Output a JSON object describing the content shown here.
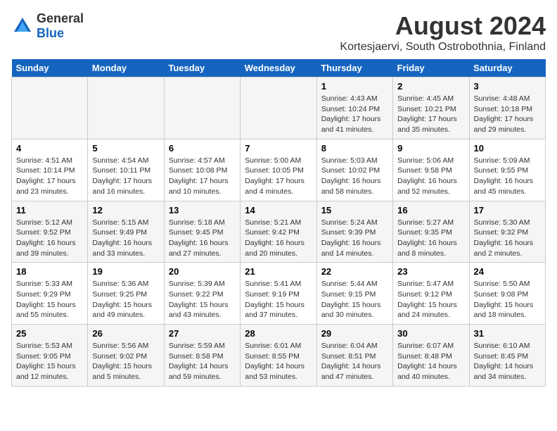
{
  "logo": {
    "general": "General",
    "blue": "Blue"
  },
  "title": "August 2024",
  "subtitle": "Kortesjaervi, South Ostrobothnia, Finland",
  "days_of_week": [
    "Sunday",
    "Monday",
    "Tuesday",
    "Wednesday",
    "Thursday",
    "Friday",
    "Saturday"
  ],
  "weeks": [
    [
      {
        "day": "",
        "info": ""
      },
      {
        "day": "",
        "info": ""
      },
      {
        "day": "",
        "info": ""
      },
      {
        "day": "",
        "info": ""
      },
      {
        "day": "1",
        "info": "Sunrise: 4:43 AM\nSunset: 10:24 PM\nDaylight: 17 hours\nand 41 minutes."
      },
      {
        "day": "2",
        "info": "Sunrise: 4:45 AM\nSunset: 10:21 PM\nDaylight: 17 hours\nand 35 minutes."
      },
      {
        "day": "3",
        "info": "Sunrise: 4:48 AM\nSunset: 10:18 PM\nDaylight: 17 hours\nand 29 minutes."
      }
    ],
    [
      {
        "day": "4",
        "info": "Sunrise: 4:51 AM\nSunset: 10:14 PM\nDaylight: 17 hours\nand 23 minutes."
      },
      {
        "day": "5",
        "info": "Sunrise: 4:54 AM\nSunset: 10:11 PM\nDaylight: 17 hours\nand 16 minutes."
      },
      {
        "day": "6",
        "info": "Sunrise: 4:57 AM\nSunset: 10:08 PM\nDaylight: 17 hours\nand 10 minutes."
      },
      {
        "day": "7",
        "info": "Sunrise: 5:00 AM\nSunset: 10:05 PM\nDaylight: 17 hours\nand 4 minutes."
      },
      {
        "day": "8",
        "info": "Sunrise: 5:03 AM\nSunset: 10:02 PM\nDaylight: 16 hours\nand 58 minutes."
      },
      {
        "day": "9",
        "info": "Sunrise: 5:06 AM\nSunset: 9:58 PM\nDaylight: 16 hours\nand 52 minutes."
      },
      {
        "day": "10",
        "info": "Sunrise: 5:09 AM\nSunset: 9:55 PM\nDaylight: 16 hours\nand 45 minutes."
      }
    ],
    [
      {
        "day": "11",
        "info": "Sunrise: 5:12 AM\nSunset: 9:52 PM\nDaylight: 16 hours\nand 39 minutes."
      },
      {
        "day": "12",
        "info": "Sunrise: 5:15 AM\nSunset: 9:49 PM\nDaylight: 16 hours\nand 33 minutes."
      },
      {
        "day": "13",
        "info": "Sunrise: 5:18 AM\nSunset: 9:45 PM\nDaylight: 16 hours\nand 27 minutes."
      },
      {
        "day": "14",
        "info": "Sunrise: 5:21 AM\nSunset: 9:42 PM\nDaylight: 16 hours\nand 20 minutes."
      },
      {
        "day": "15",
        "info": "Sunrise: 5:24 AM\nSunset: 9:39 PM\nDaylight: 16 hours\nand 14 minutes."
      },
      {
        "day": "16",
        "info": "Sunrise: 5:27 AM\nSunset: 9:35 PM\nDaylight: 16 hours\nand 8 minutes."
      },
      {
        "day": "17",
        "info": "Sunrise: 5:30 AM\nSunset: 9:32 PM\nDaylight: 16 hours\nand 2 minutes."
      }
    ],
    [
      {
        "day": "18",
        "info": "Sunrise: 5:33 AM\nSunset: 9:29 PM\nDaylight: 15 hours\nand 55 minutes."
      },
      {
        "day": "19",
        "info": "Sunrise: 5:36 AM\nSunset: 9:25 PM\nDaylight: 15 hours\nand 49 minutes."
      },
      {
        "day": "20",
        "info": "Sunrise: 5:39 AM\nSunset: 9:22 PM\nDaylight: 15 hours\nand 43 minutes."
      },
      {
        "day": "21",
        "info": "Sunrise: 5:41 AM\nSunset: 9:19 PM\nDaylight: 15 hours\nand 37 minutes."
      },
      {
        "day": "22",
        "info": "Sunrise: 5:44 AM\nSunset: 9:15 PM\nDaylight: 15 hours\nand 30 minutes."
      },
      {
        "day": "23",
        "info": "Sunrise: 5:47 AM\nSunset: 9:12 PM\nDaylight: 15 hours\nand 24 minutes."
      },
      {
        "day": "24",
        "info": "Sunrise: 5:50 AM\nSunset: 9:08 PM\nDaylight: 15 hours\nand 18 minutes."
      }
    ],
    [
      {
        "day": "25",
        "info": "Sunrise: 5:53 AM\nSunset: 9:05 PM\nDaylight: 15 hours\nand 12 minutes."
      },
      {
        "day": "26",
        "info": "Sunrise: 5:56 AM\nSunset: 9:02 PM\nDaylight: 15 hours\nand 5 minutes."
      },
      {
        "day": "27",
        "info": "Sunrise: 5:59 AM\nSunset: 8:58 PM\nDaylight: 14 hours\nand 59 minutes."
      },
      {
        "day": "28",
        "info": "Sunrise: 6:01 AM\nSunset: 8:55 PM\nDaylight: 14 hours\nand 53 minutes."
      },
      {
        "day": "29",
        "info": "Sunrise: 6:04 AM\nSunset: 8:51 PM\nDaylight: 14 hours\nand 47 minutes."
      },
      {
        "day": "30",
        "info": "Sunrise: 6:07 AM\nSunset: 8:48 PM\nDaylight: 14 hours\nand 40 minutes."
      },
      {
        "day": "31",
        "info": "Sunrise: 6:10 AM\nSunset: 8:45 PM\nDaylight: 14 hours\nand 34 minutes."
      }
    ]
  ]
}
